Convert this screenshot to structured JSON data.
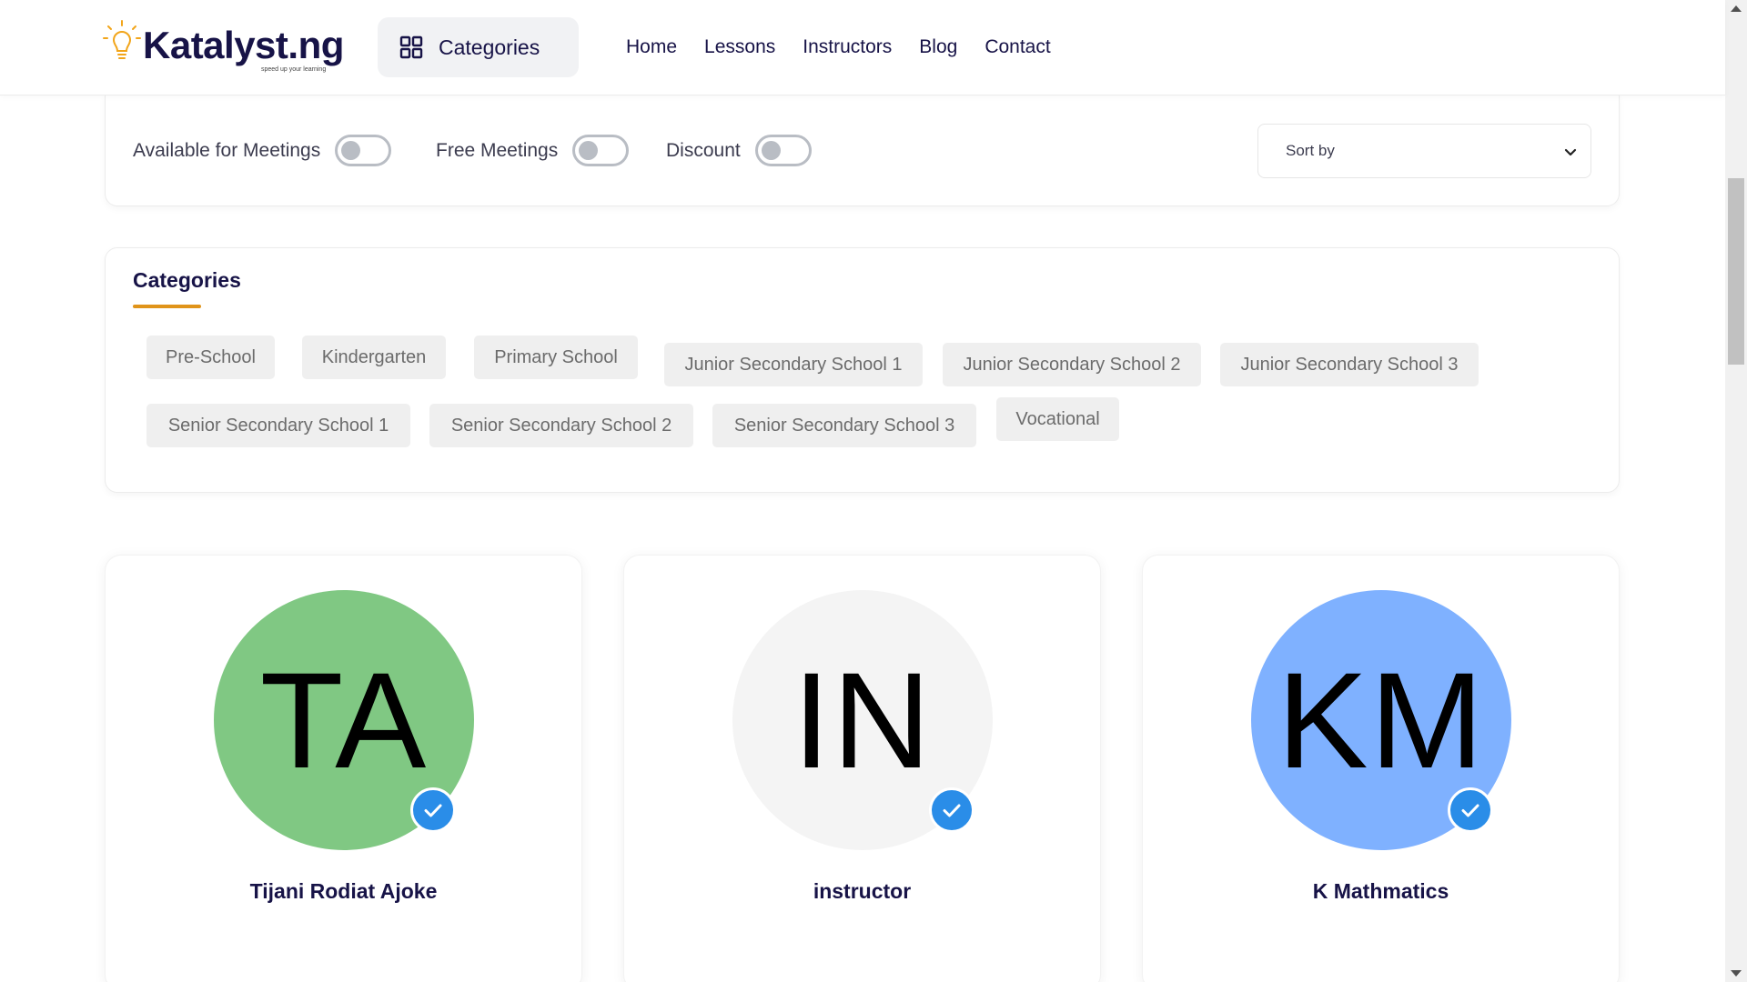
{
  "header": {
    "brand": "Katalyst.ng",
    "tagline": "speed up your learning",
    "categories_button": "Categories",
    "nav": [
      "Home",
      "Lessons",
      "Instructors",
      "Blog",
      "Contact"
    ]
  },
  "filters": {
    "toggles": [
      {
        "label": "Available for Meetings",
        "on": false
      },
      {
        "label": "Free Meetings",
        "on": false
      },
      {
        "label": "Discount",
        "on": false
      }
    ],
    "sort": {
      "selected": "Sort by"
    }
  },
  "categories": {
    "title": "Categories",
    "items": [
      "Pre-School",
      "Kindergarten",
      "Primary School",
      "Junior Secondary School 1",
      "Junior Secondary School 2",
      "Junior Secondary School 3",
      "Senior Secondary School 1",
      "Senior Secondary School 2",
      "Senior Secondary School 3",
      "Vocational"
    ]
  },
  "instructors": [
    {
      "initials": "TA",
      "name": "Tijani Rodiat Ajoke",
      "color": "#80c883",
      "verified": true
    },
    {
      "initials": "IN",
      "name": "instructor",
      "color": "#f4f4f4",
      "verified": true
    },
    {
      "initials": "KM",
      "name": "K Mathmatics",
      "color": "#7fb1ff",
      "verified": true
    }
  ],
  "colors": {
    "primary_text": "#171347",
    "accent_underline": "#e0941a",
    "verified_badge": "#2a8de8",
    "chip_bg": "#efefef"
  },
  "icons": {
    "logo": "lightbulb-icon",
    "categories": "grid-icon",
    "sort": "chevron-down-icon",
    "verified": "check-icon"
  }
}
